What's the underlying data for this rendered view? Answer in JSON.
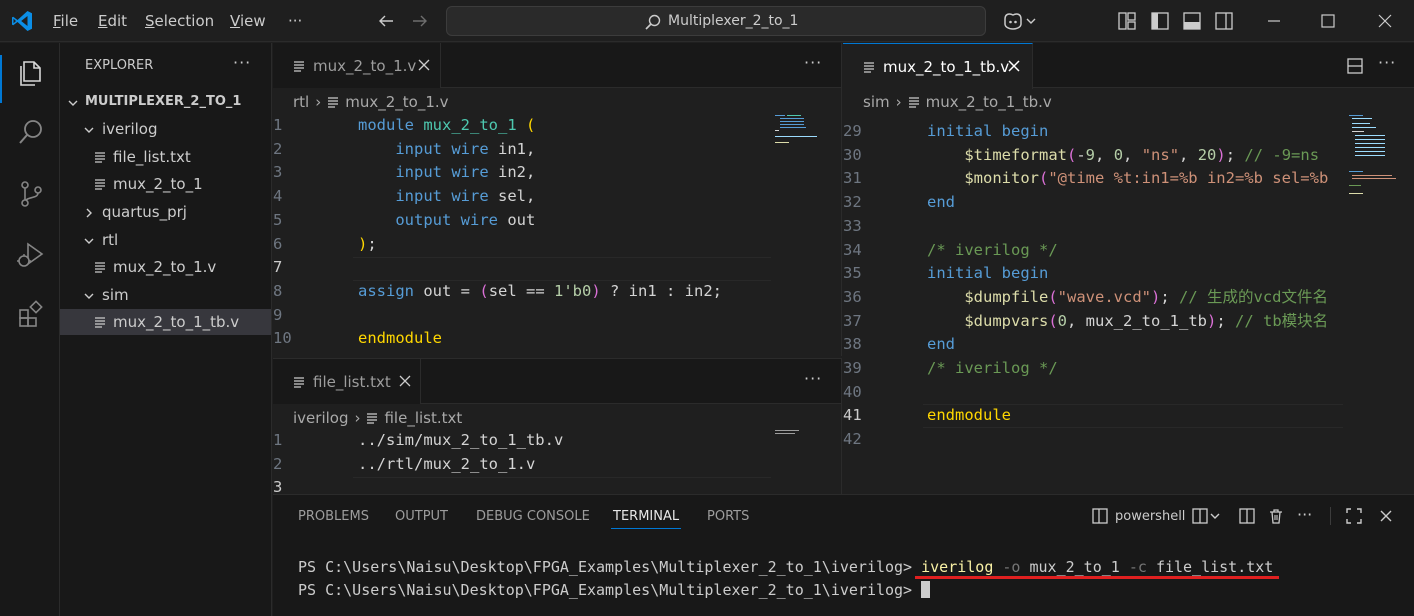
{
  "titlebar": {
    "menus": [
      "File",
      "Edit",
      "Selection",
      "View"
    ],
    "more": "···",
    "search_text": "Multiplexer_2_to_1"
  },
  "activity_icons": [
    "explorer-icon",
    "search-icon",
    "source-control-icon",
    "run-debug-icon",
    "extensions-icon"
  ],
  "sidebar": {
    "title": "EXPLORER",
    "more": "···",
    "root": "MULTIPLEXER_2_TO_1",
    "items": [
      {
        "label": "iverilog",
        "type": "folder",
        "open": true
      },
      {
        "label": "file_list.txt",
        "type": "file"
      },
      {
        "label": "mux_2_to_1",
        "type": "file"
      },
      {
        "label": "quartus_prj",
        "type": "folder",
        "open": false
      },
      {
        "label": "rtl",
        "type": "folder",
        "open": true
      },
      {
        "label": "mux_2_to_1.v",
        "type": "file"
      },
      {
        "label": "sim",
        "type": "folder",
        "open": true
      },
      {
        "label": "mux_2_to_1_tb.v",
        "type": "file",
        "selected": true
      }
    ]
  },
  "editor_left_top": {
    "tab": "mux_2_to_1.v",
    "breadcrumb": [
      "rtl",
      "mux_2_to_1.v"
    ],
    "line_numbers": [
      "1",
      "2",
      "3",
      "4",
      "5",
      "6",
      "7",
      "8",
      "9",
      "10"
    ],
    "current_line": "7"
  },
  "editor_left_bottom": {
    "tab": "file_list.txt",
    "breadcrumb": [
      "iverilog",
      "file_list.txt"
    ],
    "line_numbers": [
      "1",
      "2",
      "3"
    ],
    "lines": [
      "../sim/mux_2_to_1_tb.v",
      "../rtl/mux_2_to_1.v"
    ]
  },
  "editor_right": {
    "tab": "mux_2_to_1_tb.v",
    "breadcrumb": [
      "sim",
      "mux_2_to_1_tb.v"
    ],
    "line_numbers": [
      "29",
      "30",
      "31",
      "32",
      "33",
      "34",
      "35",
      "36",
      "37",
      "38",
      "39",
      "40",
      "41",
      "42"
    ],
    "current_line": "41"
  },
  "panel": {
    "tabs": [
      "PROBLEMS",
      "OUTPUT",
      "DEBUG CONSOLE",
      "TERMINAL",
      "PORTS"
    ],
    "active_tab": "TERMINAL",
    "shell": "powershell",
    "prompt": "PS C:\\Users\\Naisu\\Desktop\\FPGA_Examples\\Multiplexer_2_to_1\\iverilog>",
    "command": {
      "cmd": "iverilog",
      "flag1": "-o",
      "val1": "mux_2_to_1",
      "flag2": "-c",
      "val2": "file_list.txt"
    }
  },
  "colors": {
    "accent": "#0078d4",
    "highlight_underline": "#e02020"
  }
}
